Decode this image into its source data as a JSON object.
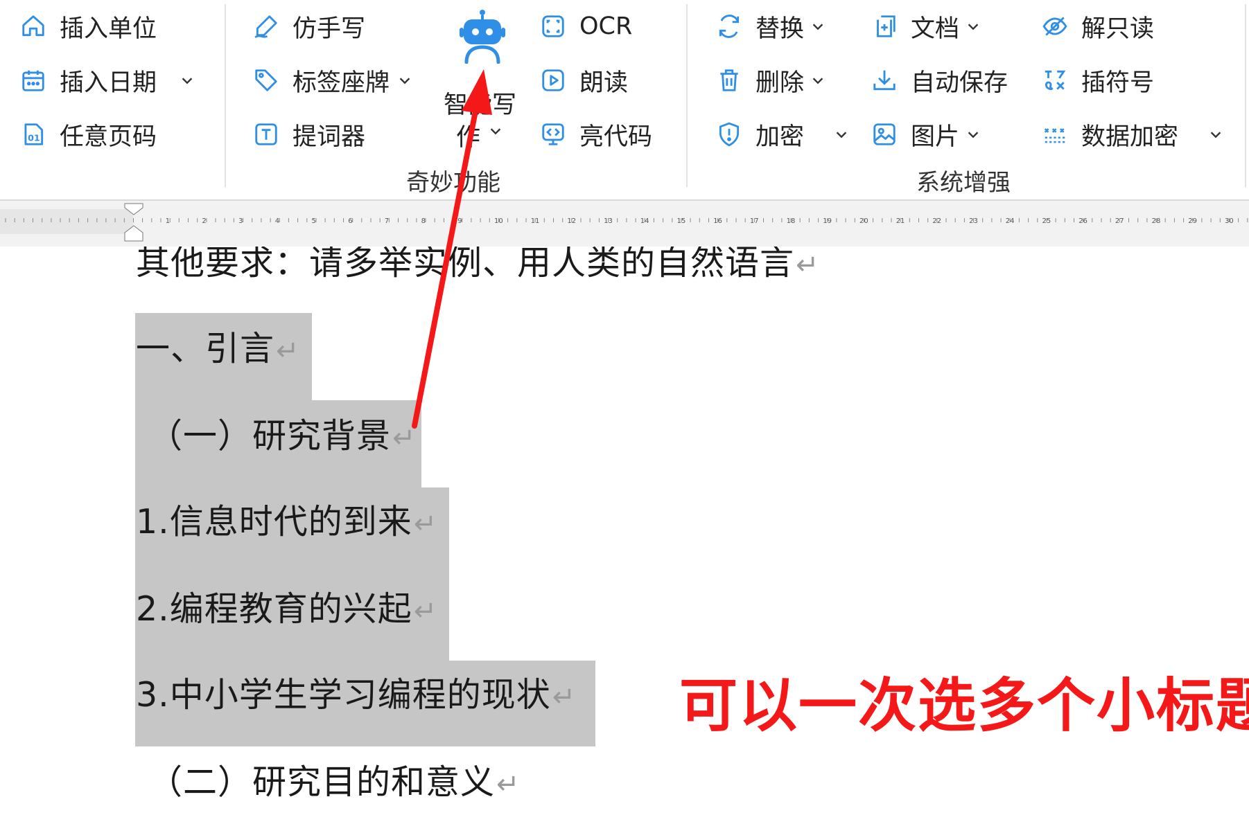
{
  "ribbon": {
    "group1": {
      "insert_unit": "插入单位",
      "insert_date": "插入日期",
      "any_page_number": "任意页码"
    },
    "group2": {
      "imitate_handwriting": "仿手写",
      "label_name_card": "标签座牌",
      "teleprompter": "提词器",
      "ai_writing_line1": "智能写",
      "ai_writing_line2": "作",
      "ocr": "OCR",
      "read_aloud": "朗读",
      "highlight_code": "亮代码",
      "group_label": "奇妙功能"
    },
    "group3": {
      "replace": "替换",
      "document": "文档",
      "remove_readonly": "解只读",
      "delete": "删除",
      "auto_save": "自动保存",
      "insert_symbol": "插符号",
      "encrypt": "加密",
      "image": "图片",
      "data_encrypt": "数据加密",
      "group_label": "系统增强"
    }
  },
  "ruler": {
    "numbers": [
      "1",
      "2",
      "3",
      "4",
      "5",
      "6",
      "7",
      "8",
      "9",
      "10",
      "11",
      "12",
      "13",
      "14",
      "15",
      "16",
      "17",
      "18",
      "19",
      "20",
      "21",
      "22",
      "23",
      "24",
      "25",
      "26",
      "27",
      "28",
      "29",
      "30"
    ]
  },
  "document": {
    "lines": [
      "其他要求：请多举实例、用人类的自然语言",
      "一、引言",
      "（一）研究背景",
      "1.信息时代的到来",
      "2.编程教育的兴起",
      "3.中小学生学习编程的现状",
      "（二）研究目的和意义"
    ],
    "paragraph_mark": "↵"
  },
  "annotation": {
    "note": "可以一次选多个小标题",
    "arrow_color": "#f41818"
  },
  "colors": {
    "icon_blue": "#2f8fe6",
    "selection_gray": "#c6c6c6",
    "annotation_red": "#f41818"
  }
}
